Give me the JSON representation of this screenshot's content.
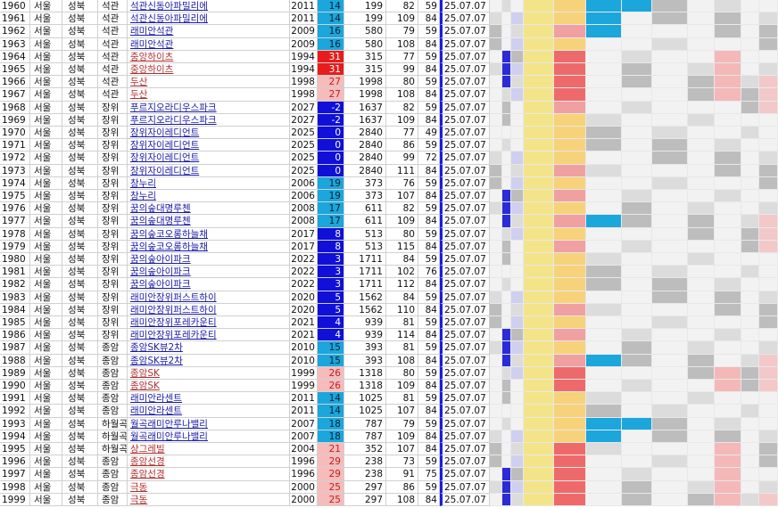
{
  "colors": {
    "badge_blue": "#1b6fe0",
    "badge_blue_dark": "#1010d8",
    "badge_cyan": "#1ba6dc",
    "badge_red": "#e81c1c",
    "badge_pink": "#f6bcbc",
    "yellow_band": "#f3e48a",
    "date_border": "#1b1be0"
  },
  "rows": [
    {
      "idx": "1960",
      "c1": "서울",
      "c2": "성북",
      "c3": "석관",
      "name": "석관신동아파밀리에",
      "year": "2011",
      "b": "14",
      "bc": "cyan",
      "v1": "199",
      "v2": "82",
      "v3": "59",
      "date": "25.07.07"
    },
    {
      "idx": "1961",
      "c1": "서울",
      "c2": "성북",
      "c3": "석관",
      "name": "석관신동아파밀리에",
      "year": "2011",
      "b": "14",
      "bc": "cyan",
      "v1": "199",
      "v2": "109",
      "v3": "84",
      "date": "25.07.07"
    },
    {
      "idx": "1962",
      "c1": "서울",
      "c2": "성북",
      "c3": "석관",
      "name": "래미안석관",
      "year": "2009",
      "b": "16",
      "bc": "cyan",
      "v1": "580",
      "v2": "79",
      "v3": "59",
      "date": "25.07.07"
    },
    {
      "idx": "1963",
      "c1": "서울",
      "c2": "성북",
      "c3": "석관",
      "name": "래미안석관",
      "year": "2009",
      "b": "16",
      "bc": "cyan",
      "v1": "580",
      "v2": "108",
      "v3": "84",
      "date": "25.07.07"
    },
    {
      "idx": "1964",
      "c1": "서울",
      "c2": "성북",
      "c3": "석관",
      "name": "중앙하이츠",
      "year": "1994",
      "b": "31",
      "bc": "red",
      "v1": "315",
      "v2": "77",
      "v3": "59",
      "date": "25.07.07",
      "red": true
    },
    {
      "idx": "1965",
      "c1": "서울",
      "c2": "성북",
      "c3": "석관",
      "name": "중앙하이츠",
      "year": "1994",
      "b": "31",
      "bc": "red",
      "v1": "315",
      "v2": "99",
      "v3": "84",
      "date": "25.07.07",
      "red": true
    },
    {
      "idx": "1966",
      "c1": "서울",
      "c2": "성북",
      "c3": "석관",
      "name": "두산",
      "year": "1998",
      "b": "27",
      "bc": "pink",
      "v1": "1998",
      "v2": "80",
      "v3": "59",
      "date": "25.07.07",
      "red": true
    },
    {
      "idx": "1967",
      "c1": "서울",
      "c2": "성북",
      "c3": "석관",
      "name": "두산",
      "year": "1998",
      "b": "27",
      "bc": "pink",
      "v1": "1998",
      "v2": "108",
      "v3": "84",
      "date": "25.07.07",
      "red": true
    },
    {
      "idx": "1968",
      "c1": "서울",
      "c2": "성북",
      "c3": "장위",
      "name": "푸르지오라디우스파크",
      "year": "2027",
      "b": "-2",
      "bc": "blue",
      "v1": "1637",
      "v2": "82",
      "v3": "59",
      "date": "25.07.07"
    },
    {
      "idx": "1969",
      "c1": "서울",
      "c2": "성북",
      "c3": "장위",
      "name": "푸르지오라디우스파크",
      "year": "2027",
      "b": "-2",
      "bc": "blue",
      "v1": "1637",
      "v2": "109",
      "v3": "84",
      "date": "25.07.07"
    },
    {
      "idx": "1970",
      "c1": "서울",
      "c2": "성북",
      "c3": "장위",
      "name": "장위자이레디언트",
      "year": "2025",
      "b": "0",
      "bc": "blue",
      "v1": "2840",
      "v2": "77",
      "v3": "49",
      "date": "25.07.07"
    },
    {
      "idx": "1971",
      "c1": "서울",
      "c2": "성북",
      "c3": "장위",
      "name": "장위자이레디언트",
      "year": "2025",
      "b": "0",
      "bc": "blue",
      "v1": "2840",
      "v2": "86",
      "v3": "59",
      "date": "25.07.07"
    },
    {
      "idx": "1972",
      "c1": "서울",
      "c2": "성북",
      "c3": "장위",
      "name": "장위자이레디언트",
      "year": "2025",
      "b": "0",
      "bc": "blue",
      "v1": "2840",
      "v2": "99",
      "v3": "72",
      "date": "25.07.07"
    },
    {
      "idx": "1973",
      "c1": "서울",
      "c2": "성북",
      "c3": "장위",
      "name": "장위자이레디언트",
      "year": "2025",
      "b": "0",
      "bc": "blue",
      "v1": "2840",
      "v2": "111",
      "v3": "84",
      "date": "25.07.07"
    },
    {
      "idx": "1974",
      "c1": "서울",
      "c2": "성북",
      "c3": "장위",
      "name": "창누리",
      "year": "2006",
      "b": "19",
      "bc": "cyan",
      "v1": "373",
      "v2": "76",
      "v3": "59",
      "date": "25.07.07"
    },
    {
      "idx": "1975",
      "c1": "서울",
      "c2": "성북",
      "c3": "장위",
      "name": "창누리",
      "year": "2006",
      "b": "19",
      "bc": "cyan",
      "v1": "373",
      "v2": "107",
      "v3": "84",
      "date": "25.07.07"
    },
    {
      "idx": "1976",
      "c1": "서울",
      "c2": "성북",
      "c3": "장위",
      "name": "꿈의숲대명루첸",
      "year": "2008",
      "b": "17",
      "bc": "cyan",
      "v1": "611",
      "v2": "82",
      "v3": "59",
      "date": "25.07.07"
    },
    {
      "idx": "1977",
      "c1": "서울",
      "c2": "성북",
      "c3": "장위",
      "name": "꿈의숲대명루첸",
      "year": "2008",
      "b": "17",
      "bc": "cyan",
      "v1": "611",
      "v2": "109",
      "v3": "84",
      "date": "25.07.07"
    },
    {
      "idx": "1978",
      "c1": "서울",
      "c2": "성북",
      "c3": "장위",
      "name": "꿈의숲코오롱하늘채",
      "year": "2017",
      "b": "8",
      "bc": "blue",
      "v1": "513",
      "v2": "80",
      "v3": "59",
      "date": "25.07.07"
    },
    {
      "idx": "1979",
      "c1": "서울",
      "c2": "성북",
      "c3": "장위",
      "name": "꿈의숲코오롱하늘채",
      "year": "2017",
      "b": "8",
      "bc": "blue",
      "v1": "513",
      "v2": "115",
      "v3": "84",
      "date": "25.07.07"
    },
    {
      "idx": "1980",
      "c1": "서울",
      "c2": "성북",
      "c3": "장위",
      "name": "꿈의숲아이파크",
      "year": "2022",
      "b": "3",
      "bc": "blue",
      "v1": "1711",
      "v2": "84",
      "v3": "59",
      "date": "25.07.07"
    },
    {
      "idx": "1981",
      "c1": "서울",
      "c2": "성북",
      "c3": "장위",
      "name": "꿈의숲아이파크",
      "year": "2022",
      "b": "3",
      "bc": "blue",
      "v1": "1711",
      "v2": "102",
      "v3": "76",
      "date": "25.07.07"
    },
    {
      "idx": "1982",
      "c1": "서울",
      "c2": "성북",
      "c3": "장위",
      "name": "꿈의숲아이파크",
      "year": "2022",
      "b": "3",
      "bc": "blue",
      "v1": "1711",
      "v2": "112",
      "v3": "84",
      "date": "25.07.07"
    },
    {
      "idx": "1983",
      "c1": "서울",
      "c2": "성북",
      "c3": "장위",
      "name": "래미안장위퍼스트하이",
      "year": "2020",
      "b": "5",
      "bc": "blue",
      "v1": "1562",
      "v2": "84",
      "v3": "59",
      "date": "25.07.07"
    },
    {
      "idx": "1984",
      "c1": "서울",
      "c2": "성북",
      "c3": "장위",
      "name": "래미안장위퍼스트하이",
      "year": "2020",
      "b": "5",
      "bc": "blue",
      "v1": "1562",
      "v2": "110",
      "v3": "84",
      "date": "25.07.07"
    },
    {
      "idx": "1985",
      "c1": "서울",
      "c2": "성북",
      "c3": "장위",
      "name": "래미안장위포레카운티",
      "year": "2021",
      "b": "4",
      "bc": "blue",
      "v1": "939",
      "v2": "81",
      "v3": "59",
      "date": "25.07.07"
    },
    {
      "idx": "1986",
      "c1": "서울",
      "c2": "성북",
      "c3": "장위",
      "name": "래미안장위포레카운티",
      "year": "2021",
      "b": "4",
      "bc": "blue",
      "v1": "939",
      "v2": "114",
      "v3": "84",
      "date": "25.07.07"
    },
    {
      "idx": "1987",
      "c1": "서울",
      "c2": "성북",
      "c3": "종암",
      "name": "종암SK뷰2차",
      "year": "2010",
      "b": "15",
      "bc": "cyan",
      "v1": "393",
      "v2": "81",
      "v3": "59",
      "date": "25.07.07"
    },
    {
      "idx": "1988",
      "c1": "서울",
      "c2": "성북",
      "c3": "종암",
      "name": "종암SK뷰2차",
      "year": "2010",
      "b": "15",
      "bc": "cyan",
      "v1": "393",
      "v2": "108",
      "v3": "84",
      "date": "25.07.07"
    },
    {
      "idx": "1989",
      "c1": "서울",
      "c2": "성북",
      "c3": "종암",
      "name": "종암SK",
      "year": "1999",
      "b": "26",
      "bc": "pink",
      "v1": "1318",
      "v2": "80",
      "v3": "59",
      "date": "25.07.07",
      "red": true
    },
    {
      "idx": "1990",
      "c1": "서울",
      "c2": "성북",
      "c3": "종암",
      "name": "종암SK",
      "year": "1999",
      "b": "26",
      "bc": "pink",
      "v1": "1318",
      "v2": "109",
      "v3": "84",
      "date": "25.07.07",
      "red": true
    },
    {
      "idx": "1991",
      "c1": "서울",
      "c2": "성북",
      "c3": "종암",
      "name": "래미안라센트",
      "year": "2011",
      "b": "14",
      "bc": "cyan",
      "v1": "1025",
      "v2": "81",
      "v3": "59",
      "date": "25.07.07"
    },
    {
      "idx": "1992",
      "c1": "서울",
      "c2": "성북",
      "c3": "종암",
      "name": "래미안라센트",
      "year": "2011",
      "b": "14",
      "bc": "cyan",
      "v1": "1025",
      "v2": "107",
      "v3": "84",
      "date": "25.07.07"
    },
    {
      "idx": "1993",
      "c1": "서울",
      "c2": "성북",
      "c3": "하월곡",
      "name": "월곡래미안루나밸리",
      "year": "2007",
      "b": "18",
      "bc": "cyan",
      "v1": "787",
      "v2": "79",
      "v3": "59",
      "date": "25.07.07"
    },
    {
      "idx": "1994",
      "c1": "서울",
      "c2": "성북",
      "c3": "하월곡",
      "name": "월곡래미안루나밸리",
      "year": "2007",
      "b": "18",
      "bc": "cyan",
      "v1": "787",
      "v2": "109",
      "v3": "84",
      "date": "25.07.07"
    },
    {
      "idx": "1995",
      "c1": "서울",
      "c2": "성북",
      "c3": "하월곡",
      "name": "상그레빌",
      "year": "2004",
      "b": "21",
      "bc": "pink",
      "v1": "352",
      "v2": "107",
      "v3": "84",
      "date": "25.07.07",
      "red": true
    },
    {
      "idx": "1996",
      "c1": "서울",
      "c2": "성북",
      "c3": "종암",
      "name": "종암선경",
      "year": "1996",
      "b": "29",
      "bc": "pink",
      "v1": "238",
      "v2": "73",
      "v3": "59",
      "date": "25.07.07",
      "red": true
    },
    {
      "idx": "1997",
      "c1": "서울",
      "c2": "성북",
      "c3": "종암",
      "name": "종암선경",
      "year": "1996",
      "b": "29",
      "bc": "pink",
      "v1": "238",
      "v2": "91",
      "v3": "75",
      "date": "25.07.07",
      "red": true
    },
    {
      "idx": "1998",
      "c1": "서울",
      "c2": "성북",
      "c3": "종암",
      "name": "극동",
      "year": "2000",
      "b": "25",
      "bc": "pink",
      "v1": "297",
      "v2": "86",
      "v3": "59",
      "date": "25.07.07",
      "red": true
    },
    {
      "idx": "1999",
      "c1": "서울",
      "c2": "성북",
      "c3": "종암",
      "name": "극동",
      "year": "2000",
      "b": "25",
      "bc": "pink",
      "v1": "297",
      "v2": "108",
      "v3": "84",
      "date": "25.07.07",
      "red": true
    }
  ]
}
